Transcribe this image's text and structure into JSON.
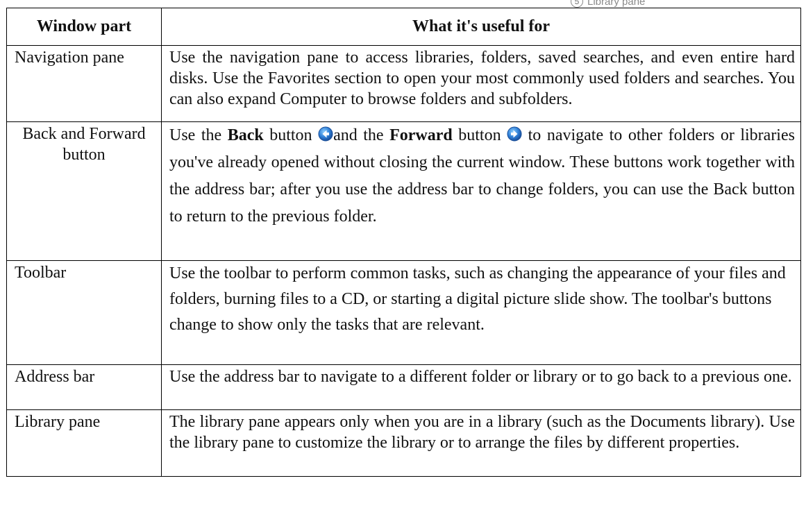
{
  "top_fragment": {
    "number": "5",
    "label": "Library pane"
  },
  "table": {
    "headers": {
      "part": "Window part",
      "use": "What it's useful for"
    },
    "rows": [
      {
        "part": "Navigation pane",
        "desc": "Use the navigation pane to access libraries, folders, saved searches, and even entire hard disks. Use the Favorites section to open your most commonly used folders and searches. You can also expand Computer to browse folders and subfolders."
      },
      {
        "part": "Back and Forward button",
        "desc_parts": {
          "p1": "Use the ",
          "back_bold": "Back",
          "p2": " button ",
          "p3": "and the ",
          "forward_bold": "Forward",
          "p4": " button ",
          "p5": " to navigate to other folders or libraries you've already opened without closing the current window. These buttons work together with the address bar; after you use the address bar to change folders, you can use the Back button to return to the previous folder."
        },
        "back_icon": "back-arrow-icon",
        "forward_icon": "forward-arrow-icon",
        "icon_color": "#2f7fd6"
      },
      {
        "part": "Toolbar",
        "desc": "Use the toolbar to perform common tasks, such as changing the appearance of your files and folders, burning files to a CD, or starting a digital picture slide show. The toolbar's buttons change to show only the tasks that are relevant."
      },
      {
        "part": "Address bar",
        "desc": "Use the address bar to navigate to a different folder or library or to go back to a previous one."
      },
      {
        "part": "Library pane",
        "desc": "The library pane appears only when you are in a library (such as the Documents library). Use the library pane to customize the library or to arrange the files by different properties."
      }
    ]
  }
}
